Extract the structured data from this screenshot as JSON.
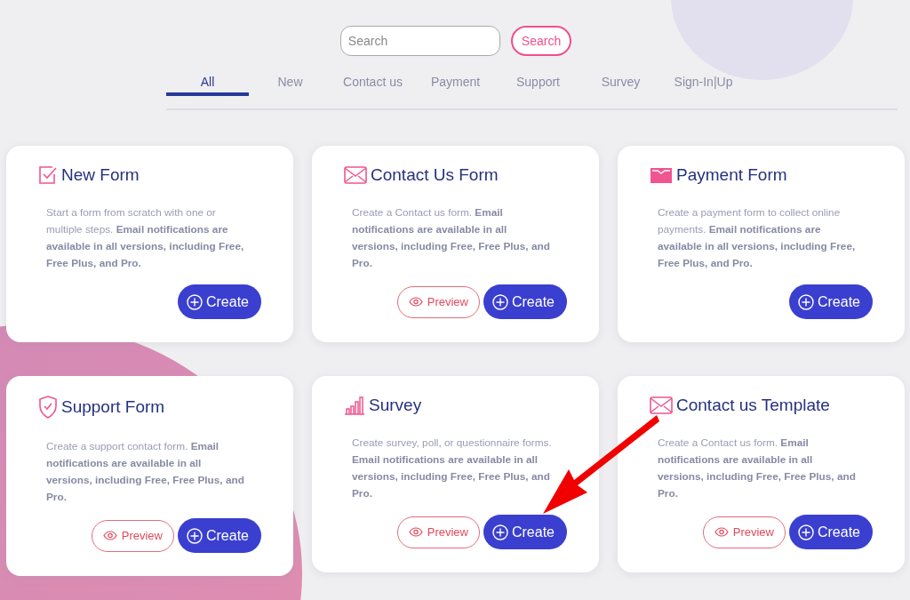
{
  "search": {
    "placeholder": "Search",
    "button": "Search"
  },
  "tabs": [
    {
      "label": "All",
      "selected": true
    },
    {
      "label": "New",
      "selected": false
    },
    {
      "label": "Contact us",
      "selected": false
    },
    {
      "label": "Payment",
      "selected": false
    },
    {
      "label": "Support",
      "selected": false
    },
    {
      "label": "Survey",
      "selected": false
    },
    {
      "label": "Sign-In|Up",
      "selected": false
    }
  ],
  "cards": [
    {
      "kind": "checkbox",
      "title": "New Form",
      "description": "Start a form from scratch with one or multiple steps. **Email notifications are available in all versions, including Free, Free Plus, and Pro.**",
      "buttons": [
        {
          "kind": "create",
          "label": "Create"
        }
      ]
    },
    {
      "kind": "envelope",
      "title": "Contact Us Form",
      "description": "Create a Contact us form. **Email notifications are available in all versions, including Free, Free Plus, and Pro.**",
      "buttons": [
        {
          "kind": "preview",
          "label": "Preview"
        },
        {
          "kind": "create",
          "label": "Create"
        }
      ]
    },
    {
      "kind": "wallet",
      "title": "Payment Form",
      "description": "Create a payment form to collect online payments. **Email notifications are available in all versions, including Free, Free Plus, and Pro.**",
      "buttons": [
        {
          "kind": "create",
          "label": "Create"
        }
      ]
    },
    {
      "kind": "shield",
      "title": "Support Form",
      "description": "Create a support contact form. **Email notifications are available in all versions, including Free, Free Plus, and Pro.**",
      "buttons": [
        {
          "kind": "preview",
          "label": "Preview"
        },
        {
          "kind": "create",
          "label": "Create"
        }
      ]
    },
    {
      "kind": "chart",
      "title": "Survey",
      "description": "Create survey, poll, or questionnaire forms. **Email notifications are available in all versions, including Free, Free Plus, and Pro.**",
      "buttons": [
        {
          "kind": "preview",
          "label": "Preview"
        },
        {
          "kind": "create",
          "label": "Create"
        }
      ]
    },
    {
      "kind": "envelope",
      "title": "Contact us Template",
      "description": "Create a Contact us form. **Email notifications are available in all versions, including Free, Free Plus, and Pro.**",
      "buttons": [
        {
          "kind": "preview",
          "label": "Preview"
        },
        {
          "kind": "create",
          "label": "Create"
        }
      ]
    }
  ]
}
